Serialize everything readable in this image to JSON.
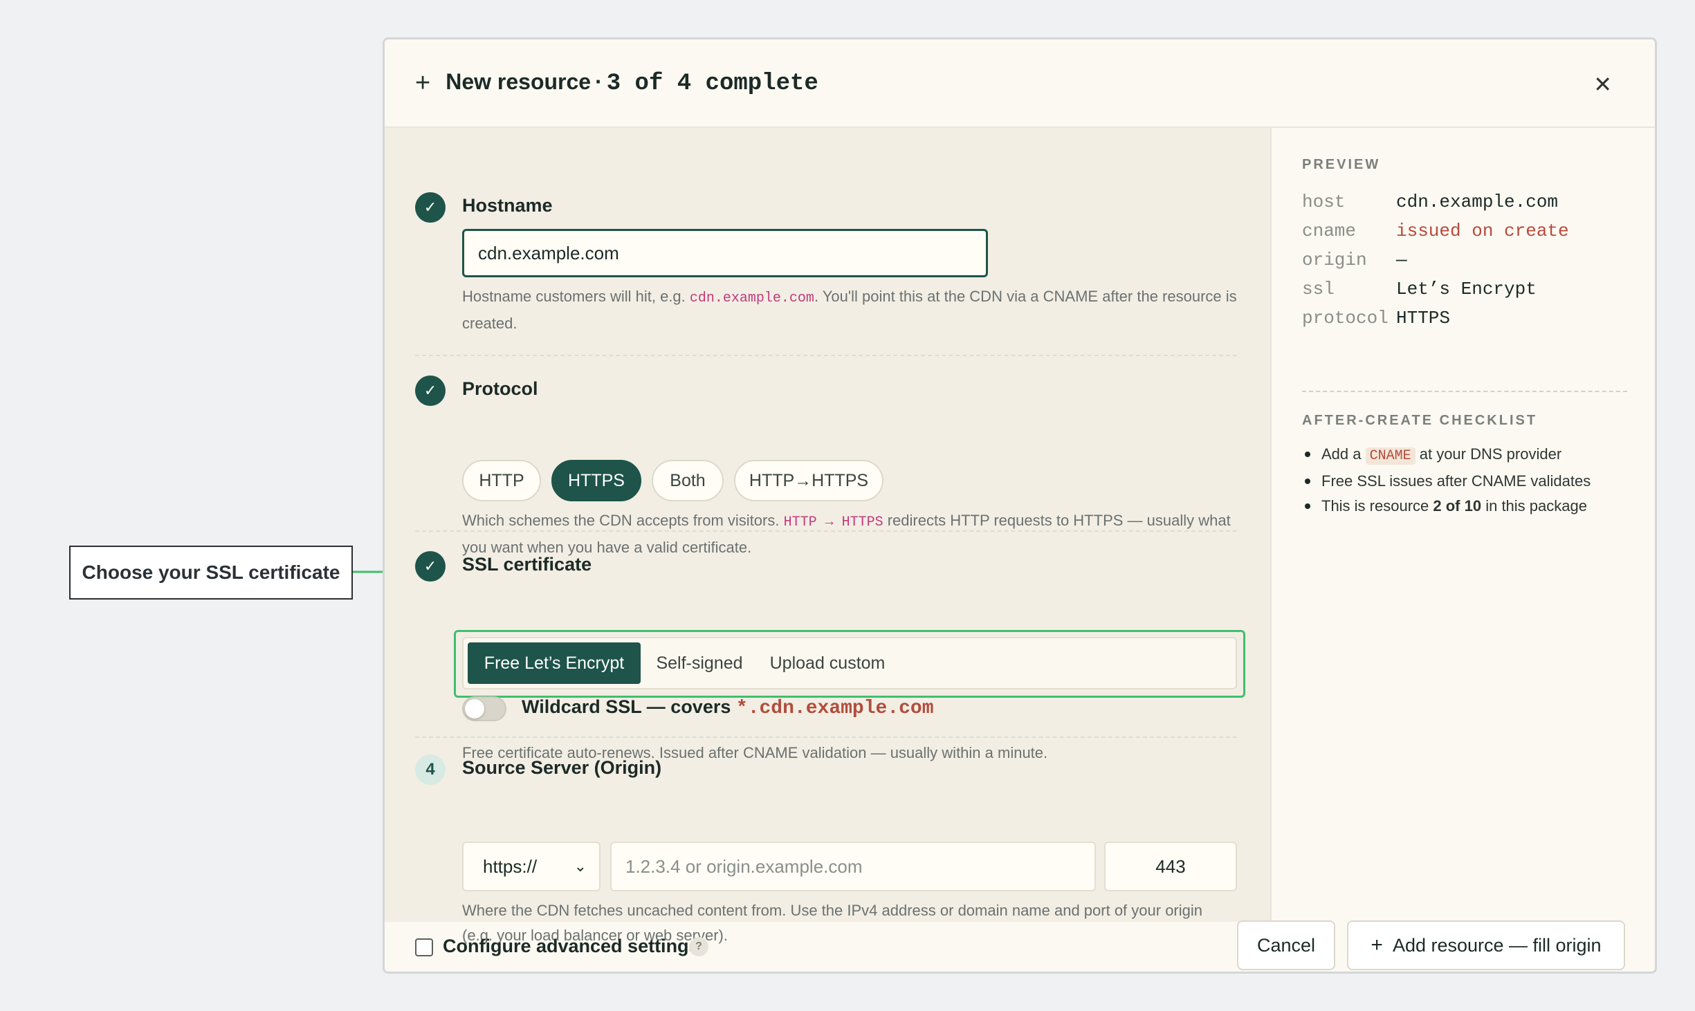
{
  "callout": {
    "text": "Choose your SSL certificate"
  },
  "header": {
    "title": "New resource",
    "separator": "·",
    "progress": "3 of 4 complete"
  },
  "steps": {
    "hostname": {
      "label": "Hostname",
      "value": "cdn.example.com",
      "help_before": "Hostname customers will hit, e.g. ",
      "help_code": "cdn.example.com",
      "help_after": ". You'll point this at the CDN via a CNAME after the resource is created."
    },
    "protocol": {
      "label": "Protocol",
      "options": [
        "HTTP",
        "HTTPS",
        "Both",
        "HTTP→HTTPS"
      ],
      "selected": "HTTPS",
      "help_before": "Which schemes the CDN accepts from visitors. ",
      "help_code": "HTTP → HTTPS",
      "help_after": " redirects HTTP requests to HTTPS — usually what you want when you have a valid certificate."
    },
    "ssl": {
      "label": "SSL certificate",
      "options": [
        "Free Let’s Encrypt",
        "Self-signed",
        "Upload custom"
      ],
      "selected": "Free Let’s Encrypt",
      "wildcard_label": "Wildcard SSL — covers",
      "wildcard_domain": "*.cdn.example.com",
      "wildcard_enabled": false,
      "help": "Free certificate auto-renews. Issued after CNAME validation — usually within a minute."
    },
    "origin": {
      "number": "4",
      "label": "Source Server (Origin)",
      "scheme": "https://",
      "host_placeholder": "1.2.3.4 or origin.example.com",
      "port": "443",
      "help": "Where the CDN fetches uncached content from. Use the IPv4 address or domain name and port of your origin (e.g. your load balancer or web server)."
    }
  },
  "preview": {
    "heading": "PREVIEW",
    "rows": [
      {
        "key": "host",
        "value": "cdn.example.com"
      },
      {
        "key": "cname",
        "value": "issued on create"
      },
      {
        "key": "origin",
        "value": "—"
      },
      {
        "key": "ssl",
        "value": "Let’s Encrypt"
      },
      {
        "key": "protocol",
        "value": "HTTPS"
      }
    ]
  },
  "checklist": {
    "heading": "AFTER-CREATE CHECKLIST",
    "item1_before": "Add a ",
    "item1_code": "CNAME",
    "item1_after": " at your DNS provider",
    "item2": "Free SSL issues after CNAME validates",
    "item3_before": "This is resource ",
    "item3_bold": "2 of 10",
    "item3_after": " in this package"
  },
  "footer": {
    "advanced_label": "Configure advanced settings",
    "help_mark": "?",
    "cancel": "Cancel",
    "submit": "Add resource — fill origin"
  },
  "colors": {
    "accent": "#1e5449",
    "highlight": "#3fc06d",
    "code": "#c23a7a",
    "cname": "#b84a3c"
  }
}
